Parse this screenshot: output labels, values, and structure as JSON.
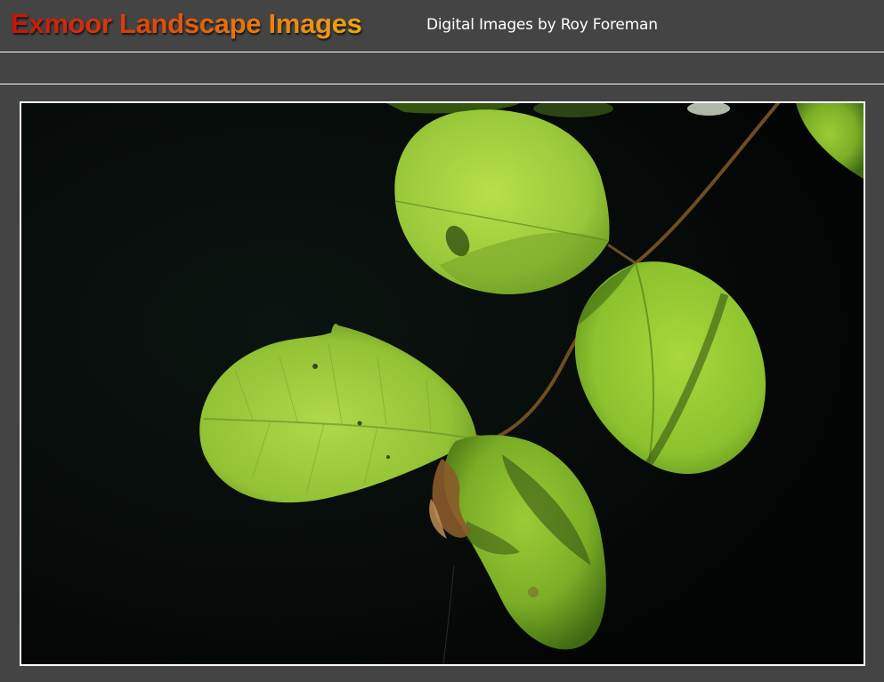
{
  "header": {
    "title": "Exmoor Landscape Images",
    "subtitle": "Digital Images by Roy Foreman"
  },
  "photo": {
    "icon": "leaves-photo",
    "description_colors": {
      "background": "#050807",
      "leaf_light": "#b9e04a",
      "leaf_mid": "#8cc22e",
      "leaf_dark": "#3f6a12",
      "stem": "#6e4e22"
    }
  }
}
